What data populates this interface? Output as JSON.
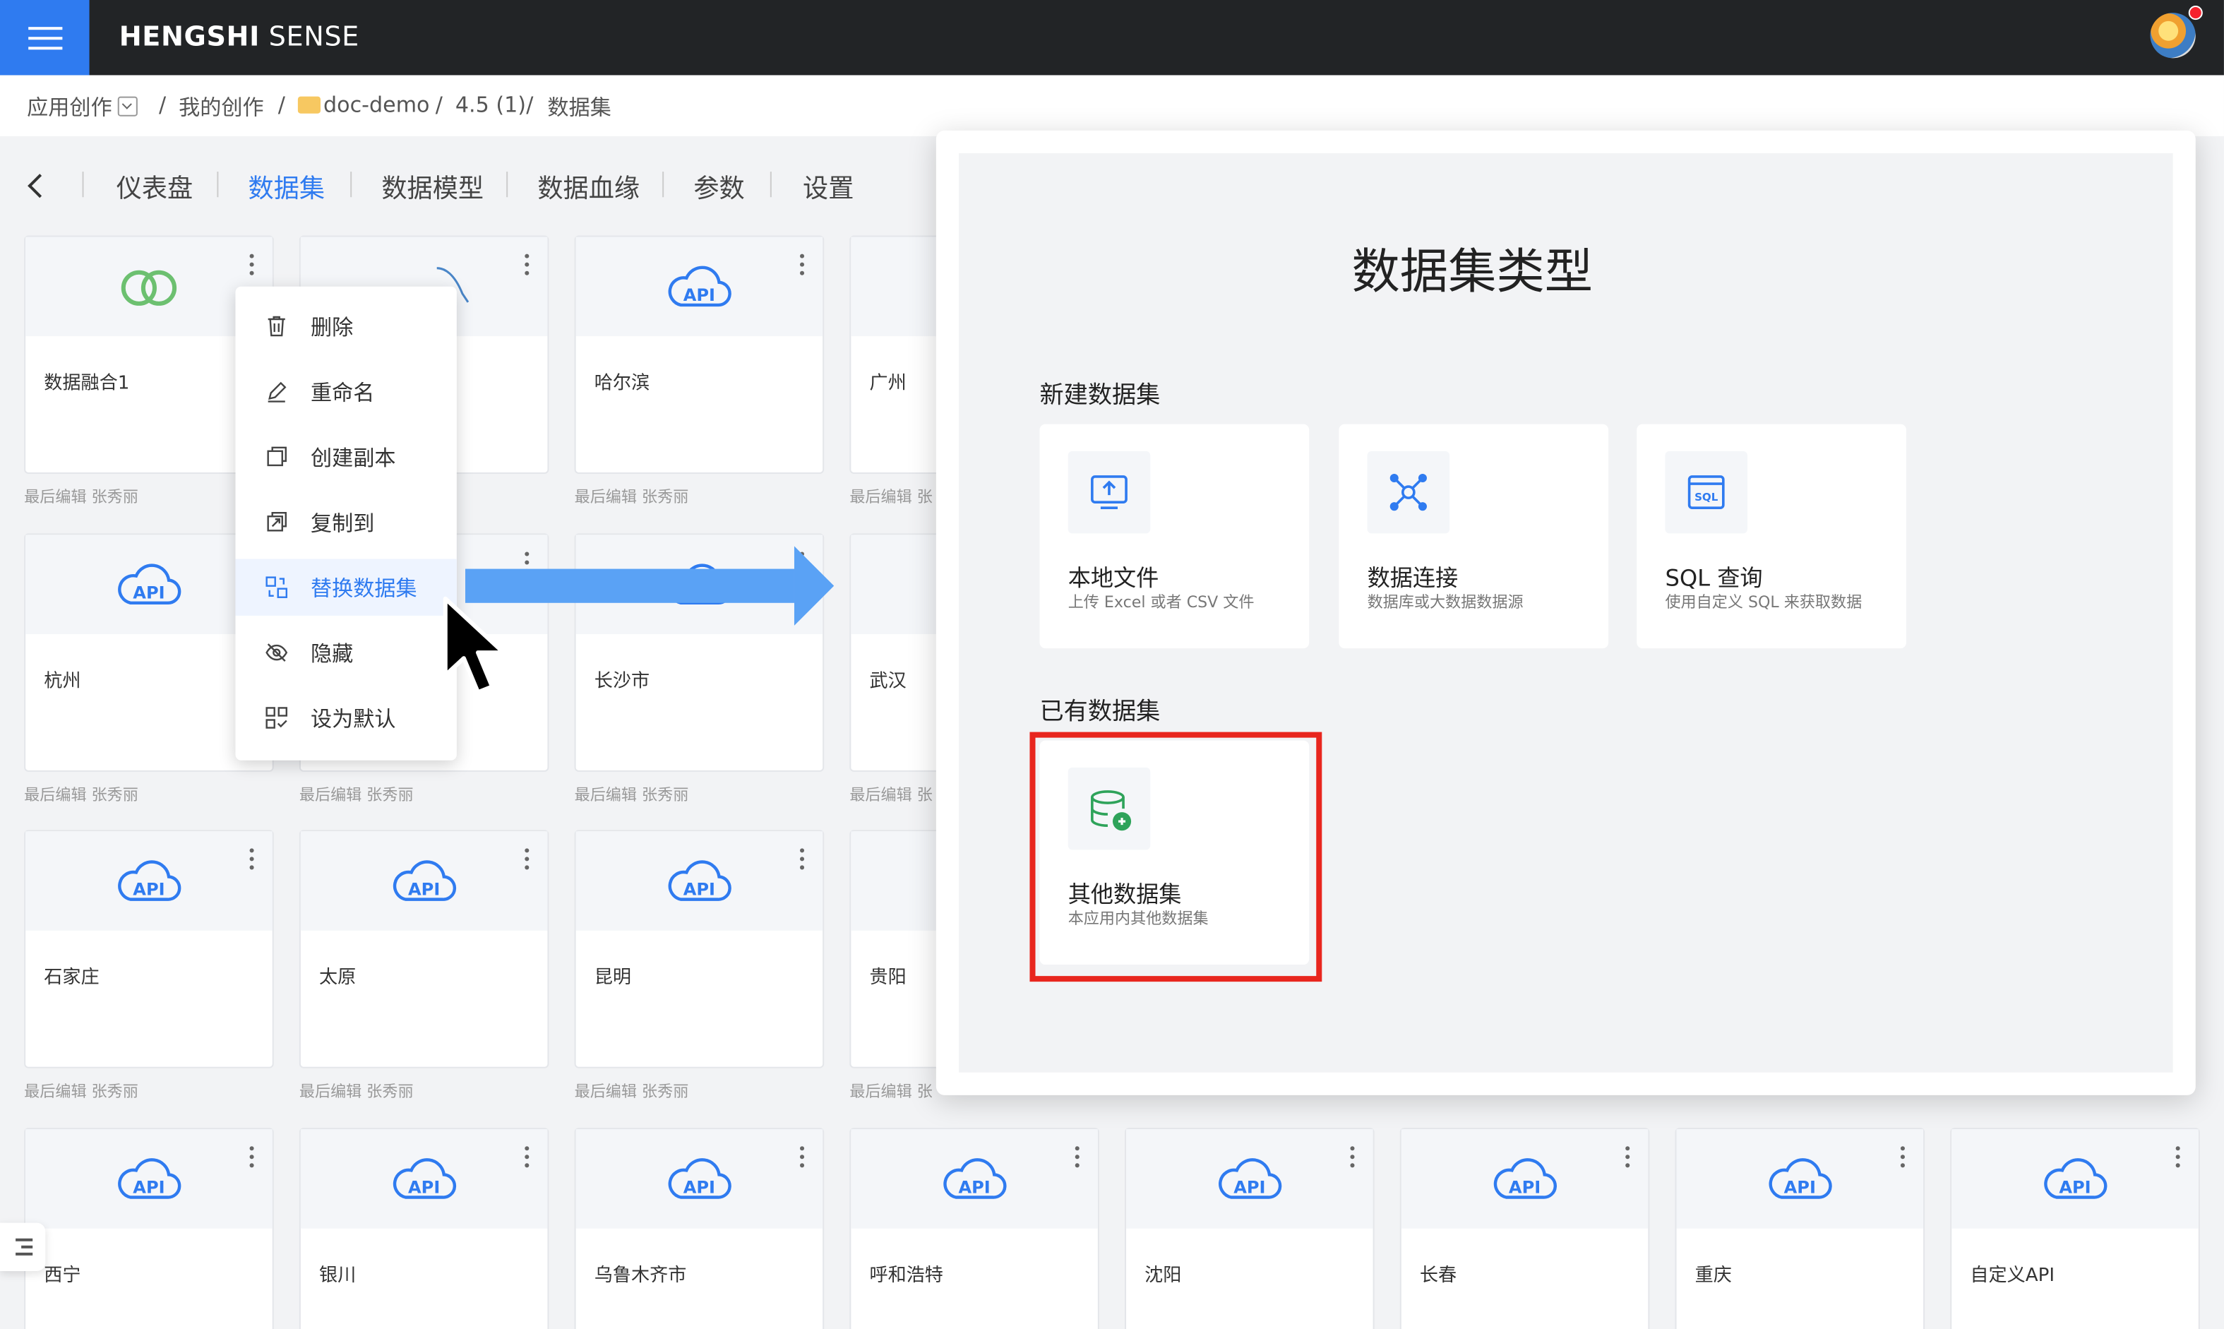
{
  "header": {
    "logo_bold": "HENGSHI",
    "logo_thin": " SENSE"
  },
  "breadcrumb": {
    "root": "应用创作",
    "my": "我的创作",
    "folder": "doc-demo",
    "version": "4.5 (1)",
    "current": "数据集",
    "sep": "/"
  },
  "tabs": [
    "仪表盘",
    "数据集",
    "数据模型",
    "数据血缘",
    "参数",
    "设置"
  ],
  "active_tab": "数据集",
  "cards": [
    {
      "name": "数据融合1",
      "meta": "最后编辑 张秀丽"
    },
    {
      "name": "",
      "meta": ""
    },
    {
      "name": "哈尔滨",
      "meta": "最后编辑 张秀丽"
    },
    {
      "name": "广州",
      "meta": "最后编辑 张"
    },
    {
      "name": "杭州",
      "meta": "最后编辑 张秀丽"
    },
    {
      "name": "",
      "meta": "最后编辑 张秀丽"
    },
    {
      "name": "长沙市",
      "meta": "最后编辑 张秀丽"
    },
    {
      "name": "武汉",
      "meta": "最后编辑 张"
    },
    {
      "name": "石家庄",
      "meta": "最后编辑 张秀丽"
    },
    {
      "name": "太原",
      "meta": "最后编辑 张秀丽"
    },
    {
      "name": "昆明",
      "meta": "最后编辑 张秀丽"
    },
    {
      "name": "贵阳",
      "meta": "最后编辑 张"
    },
    {
      "name": "西宁",
      "meta": ""
    },
    {
      "name": "银川",
      "meta": ""
    },
    {
      "name": "乌鲁木齐市",
      "meta": ""
    },
    {
      "name": "呼和浩特",
      "meta": ""
    },
    {
      "name": "沈阳",
      "meta": ""
    },
    {
      "name": "长春",
      "meta": ""
    },
    {
      "name": "重庆",
      "meta": ""
    },
    {
      "name": "自定义API",
      "meta": ""
    }
  ],
  "api_label": "API",
  "context_menu": {
    "items": [
      "删除",
      "重命名",
      "创建副本",
      "复制到",
      "替换数据集",
      "隐藏",
      "设为默认"
    ],
    "highlighted": "替换数据集"
  },
  "dialog": {
    "title": "数据集类型",
    "new_section": "新建数据集",
    "existing_section": "已有数据集",
    "types": [
      {
        "name": "本地文件",
        "desc": "上传 Excel 或者 CSV 文件",
        "icon": "upload-icon"
      },
      {
        "name": "数据连接",
        "desc": "数据库或大数据数据源",
        "icon": "network-icon"
      },
      {
        "name": "SQL 查询",
        "desc": "使用自定义 SQL 来获取数据",
        "icon": "sql-icon"
      }
    ],
    "existing": {
      "name": "其他数据集",
      "desc": "本应用内其他数据集",
      "icon": "database-icon"
    }
  },
  "colors": {
    "accent": "#2f7bf0",
    "highlight_box": "#e8261e",
    "topbar": "#222426",
    "arrow": "#5aa2f5"
  }
}
